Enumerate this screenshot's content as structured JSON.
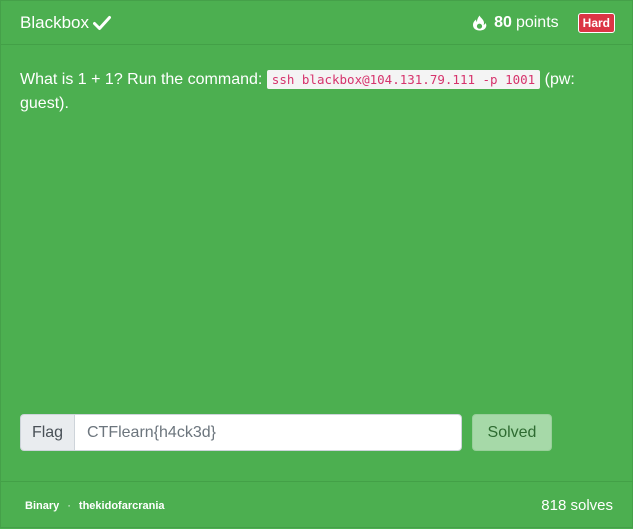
{
  "challenge": {
    "title": "Blackbox",
    "points_value": "80",
    "points_label": "points",
    "difficulty": "Hard"
  },
  "description": {
    "before": "What is 1 + 1? Run the command: ",
    "command": "ssh blackbox@104.131.79.111 -p 1001",
    "after": " (pw: guest)."
  },
  "flag_form": {
    "label": "Flag",
    "value": "CTFlearn{h4ck3d}",
    "button_label": "Solved"
  },
  "footer": {
    "category": "Binary",
    "separator": "·",
    "author": "thekidofarcrania",
    "solves": "818 solves"
  },
  "colors": {
    "card_bg": "#4caf50",
    "badge_bg": "#dc3545",
    "code_text": "#d6336c",
    "button_bg": "#a6d9a8"
  }
}
